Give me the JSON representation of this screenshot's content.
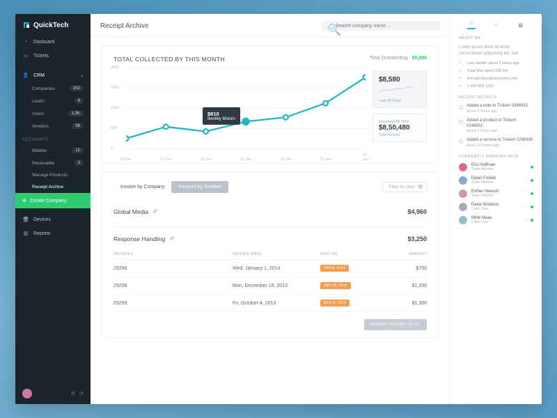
{
  "brand": "QuickTech",
  "sidebar": {
    "top": [
      {
        "label": "Dasboard",
        "icon": "gauge"
      },
      {
        "label": "Tickets",
        "icon": "ticket"
      }
    ],
    "crm": {
      "label": "CRM",
      "items": [
        {
          "label": "Companies",
          "badge": "302"
        },
        {
          "label": "Leads",
          "badge": "8"
        },
        {
          "label": "Users",
          "badge": "1,3K"
        },
        {
          "label": "Vendors",
          "badge": "58"
        }
      ]
    },
    "accounts_h": "ACCOUNTS",
    "accounts": [
      {
        "label": "Billable",
        "badge": "12"
      },
      {
        "label": "Receivable",
        "badge": "3"
      },
      {
        "label": "Manage Products"
      },
      {
        "label": "Receipt Archive"
      }
    ],
    "create": "Create Company",
    "bottom": [
      {
        "label": "Devices",
        "icon": "monitor"
      },
      {
        "label": "Reports",
        "icon": "chart"
      }
    ]
  },
  "page": {
    "title": "Receipt Archive",
    "search_ph": "Search company name…"
  },
  "chart": {
    "title": "TOTAL COLLECTED BY THIS MONTH",
    "out_label": "Total Outstanding · ",
    "out_amt": "$5,890",
    "box30_amt": "$8,580",
    "box30_sub": "Last 30 Days",
    "boxall_pre": "Received All Time",
    "boxall_amt": "$8,50,480",
    "boxall_sub": "Total Income",
    "tooltip_amt": "$810",
    "tooltip_name": "Bentley Motors"
  },
  "chart_data": {
    "type": "line",
    "categories": [
      "26 Dec",
      "31 Dec",
      "06 Jan",
      "11 Jan",
      "18 Jan",
      "22 Jan",
      "27 Jan"
    ],
    "values": [
      450,
      700,
      600,
      810,
      900,
      1200,
      1750
    ],
    "ylabels": [
      "0",
      "500",
      "1000",
      "1500",
      "2000"
    ],
    "ylim": [
      0,
      2000
    ],
    "highlight_index": 3
  },
  "table": {
    "tabs": [
      "Invoice by Company",
      "Invoices by Number"
    ],
    "filter_ph": "Filter by date",
    "groups": [
      {
        "name": "Global Media",
        "amount": "$4,960"
      },
      {
        "name": "Response Handling",
        "amount": "$3,250"
      }
    ],
    "cols": {
      "id": "INVOICE#",
      "date": "INVOICE DATE",
      "paid": "PAID ON",
      "amt": "AMOUNT"
    },
    "rows": [
      {
        "id": "29296",
        "date": "Wed, January 1, 2014",
        "paid": "JAN 8, 2014",
        "amt": "$750"
      },
      {
        "id": "29298",
        "date": "Mon, December 16, 2013",
        "paid": "JAN 18, 2014",
        "amt": "$1,200"
      },
      {
        "id": "29299",
        "date": "Fri, October 4, 2013",
        "paid": "NOV 8, 2013",
        "amt": "$1,300"
      }
    ],
    "export": "EXPORT REPORT TO XL"
  },
  "right": {
    "about_h": "ABOUT ME",
    "about_txt": "Lorem ipsum dolor sit amet, consectetuer adipiscing elit, sed",
    "meta": [
      "Last update about 2 hours ago",
      "Total time spent 230 hrs",
      "tom.pecheux@quicktech.com",
      "1 406 555 1212"
    ],
    "recent_h": "RECENT ACTIVITY",
    "recent": [
      {
        "t": "Added a note to Ticket# 0246932",
        "s": "about 2 hours ago"
      },
      {
        "t": "Added a product to Ticket# 0246932",
        "s": "about 3 hours ago"
      },
      {
        "t": "Added a service to Ticket# 0246930",
        "s": "about 16 hours ago"
      }
    ],
    "team_h": "CURRENTLY WORKING WITH",
    "team": [
      {
        "n": "Eric Hoffman",
        "r": "Team Member"
      },
      {
        "n": "Dylan Fosket",
        "r": "Team Member"
      },
      {
        "n": "Esther Heesch",
        "r": "Team Member"
      },
      {
        "n": "Daria Strokous",
        "r": "Client User"
      },
      {
        "n": "Mirte Maas",
        "r": "Client User"
      }
    ]
  }
}
